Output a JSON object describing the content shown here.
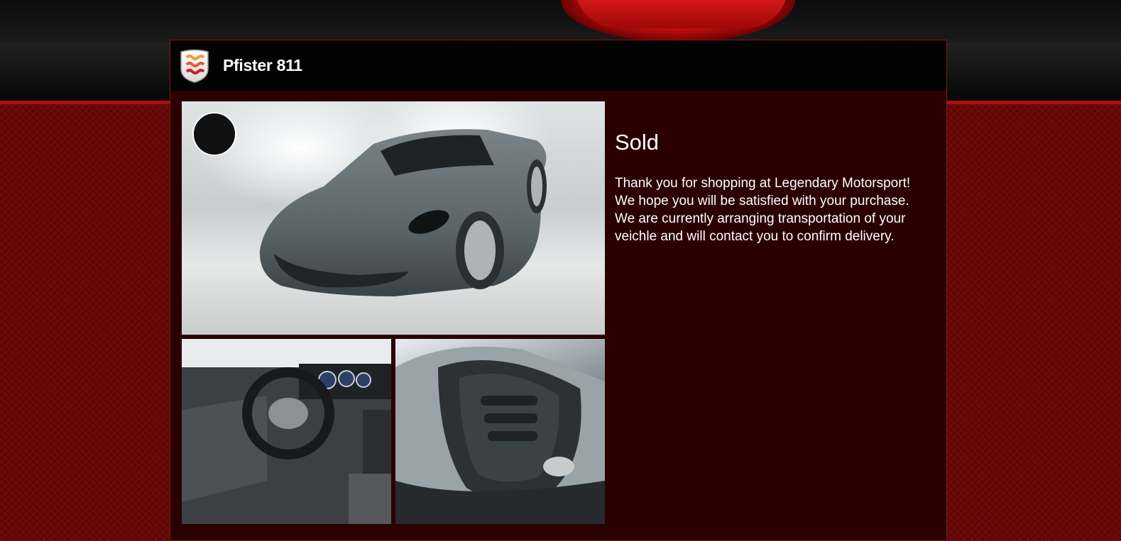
{
  "vehicle": {
    "name": "Pfister 811",
    "brand_logo_icon": "pfister-brand-icon"
  },
  "status": {
    "title": "Sold",
    "message": "Thank you for shopping at Legendary Motorsport! We hope you will be satisfied with your purchase. We are currently arranging transportation of your veichle and will contact you to confirm delivery."
  },
  "gallery": {
    "images": [
      "car-exterior-front-photo",
      "car-interior-photo",
      "car-engine-bay-photo"
    ]
  },
  "colors": {
    "accent": "#b10d0d",
    "panel_background": "#2a0000",
    "header_background": "#020202"
  }
}
